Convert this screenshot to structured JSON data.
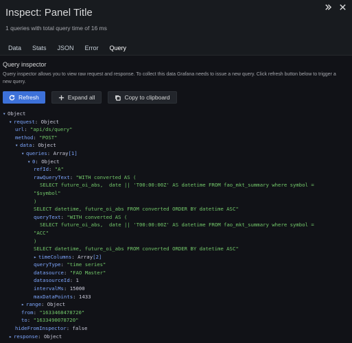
{
  "header": {
    "title": "Inspect: Panel Title",
    "subtitle": "1 queries with total query time of 16 ms",
    "icons": [
      "expand-icon",
      "close-icon"
    ]
  },
  "tabs": [
    "Data",
    "Stats",
    "JSON",
    "Error",
    "Query"
  ],
  "active_tab": "Query",
  "accent_color": "#f3843c",
  "query_inspector": {
    "title": "Query inspector",
    "description": "Query inspector allows you to view raw request and response. To collect this data Grafana needs to issue a new query. Click refresh button below to trigger a new query.",
    "refresh_label": "Refresh",
    "expand_label": "Expand all",
    "copy_label": "Copy to clipboard"
  },
  "tree": [
    {
      "d": 0,
      "caret": "open",
      "key": "Object",
      "type": "root"
    },
    {
      "d": 1,
      "caret": "open",
      "key": "request",
      "val": "Object",
      "vtype": "obj"
    },
    {
      "d": 2,
      "key": "url",
      "val": "\"api/ds/query\"",
      "vtype": "str"
    },
    {
      "d": 2,
      "key": "method",
      "val": "\"POST\"",
      "vtype": "str"
    },
    {
      "d": 2,
      "caret": "open",
      "key": "data",
      "val": "Object",
      "vtype": "obj"
    },
    {
      "d": 3,
      "caret": "open",
      "key": "queries",
      "val": "Array",
      "count": "[1]",
      "vtype": "arr"
    },
    {
      "d": 4,
      "caret": "open",
      "key": "0",
      "val": "Object",
      "vtype": "obj"
    },
    {
      "d": 5,
      "key": "refId",
      "val": "\"A\"",
      "vtype": "str"
    },
    {
      "d": 5,
      "key": "rawQueryText",
      "val": "\"WITH converted AS (",
      "vtype": "str"
    },
    {
      "d": 6,
      "text": "SELECT future_oi_abs,  date || 'T00:00:00Z' AS datetime FROM fao_mkt_summary where symbol =",
      "vtype": "str"
    },
    {
      "d": 5,
      "text": "\"$symbol\"",
      "vtype": "str"
    },
    {
      "d": 5,
      "text": ")",
      "vtype": "str"
    },
    {
      "d": 5,
      "text": "SELECT datetime, future_oi_abs FROM converted ORDER BY datetime ASC\"",
      "vtype": "str"
    },
    {
      "d": 5,
      "key": "queryText",
      "val": "\"WITH converted AS (",
      "vtype": "str"
    },
    {
      "d": 6,
      "text": "SELECT future_oi_abs,  date || 'T00:00:00Z' AS datetime FROM fao_mkt_summary where symbol =",
      "vtype": "str"
    },
    {
      "d": 5,
      "text": "\"ACC\"",
      "vtype": "str"
    },
    {
      "d": 5,
      "text": ")",
      "vtype": "str"
    },
    {
      "d": 5,
      "text": "SELECT datetime, future_oi_abs FROM converted ORDER BY datetime ASC\"",
      "vtype": "str"
    },
    {
      "d": 5,
      "caret": "closed",
      "key": "timeColumns",
      "val": "Array",
      "count": "[2]",
      "vtype": "arr"
    },
    {
      "d": 5,
      "key": "queryType",
      "val": "\"time series\"",
      "vtype": "str"
    },
    {
      "d": 5,
      "key": "datasource",
      "val": "\"FAO Master\"",
      "vtype": "str"
    },
    {
      "d": 5,
      "key": "datasourceId",
      "val": "1",
      "vtype": "num"
    },
    {
      "d": 5,
      "key": "intervalMs",
      "val": "15000",
      "vtype": "num"
    },
    {
      "d": 5,
      "key": "maxDataPoints",
      "val": "1433",
      "vtype": "num"
    },
    {
      "d": 3,
      "caret": "closed",
      "key": "range",
      "val": "Object",
      "vtype": "obj"
    },
    {
      "d": 3,
      "key": "from",
      "val": "\"1633468478720\"",
      "vtype": "str"
    },
    {
      "d": 3,
      "key": "to",
      "val": "\"1633490078720\"",
      "vtype": "str"
    },
    {
      "d": 2,
      "key": "hideFromInspector",
      "val": "false",
      "vtype": "num"
    },
    {
      "d": 1,
      "caret": "closed",
      "key": "response",
      "val": "Object",
      "vtype": "obj"
    }
  ]
}
